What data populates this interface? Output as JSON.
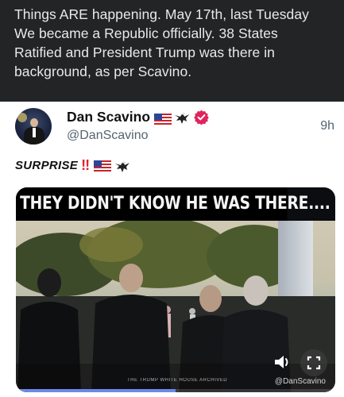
{
  "caption": {
    "lines": [
      "Things ARE happening. May 17th, last Tuesday",
      "We became a Republic officially. 38 States",
      "Ratified and President Trump was there in",
      "background, as per Scavino."
    ]
  },
  "tweet": {
    "display_name": "Dan Scavino",
    "handle": "@DanScavino",
    "timestamp": "9h",
    "text_word": "SURPRISE",
    "text_bangs": "!!",
    "icons": [
      "us-flag-icon",
      "eagle-icon",
      "verified-badge-icon"
    ]
  },
  "media": {
    "headline": "THEY DIDN'T KNOW HE WAS THERE....",
    "watermark": "@DanScavino",
    "footer_label": "THE TRUMP WHITE HOUSE ARCHIVED",
    "progress": 0.5,
    "controls": [
      "sound-icon",
      "fullscreen-icon"
    ]
  },
  "colors": {
    "caption_bg": "#222426",
    "caption_text": "#e9e9e9",
    "handle_gray": "#536471",
    "verified": "#e0245e",
    "progress": "#6d88e8"
  }
}
